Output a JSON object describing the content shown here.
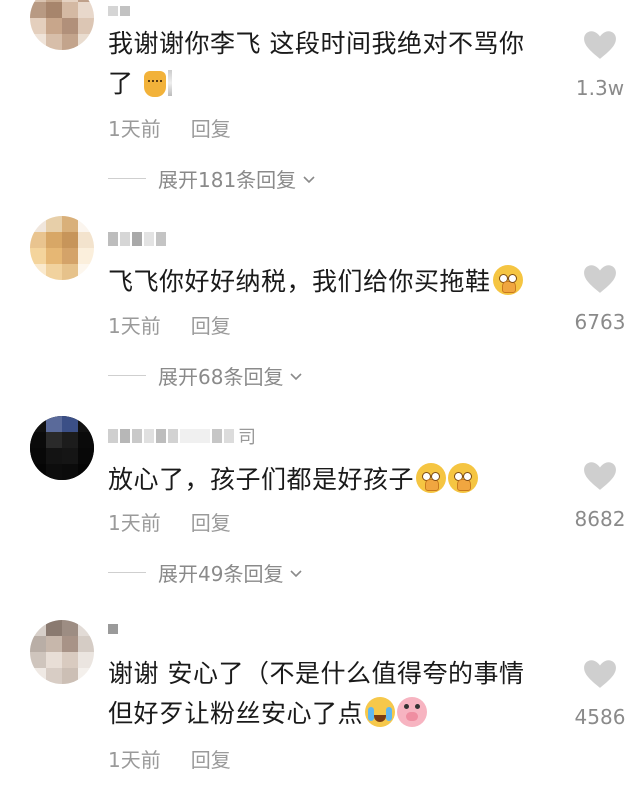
{
  "colors": {
    "heart": "#cfcfcf",
    "meta_text": "#9a9a9a",
    "body_text": "#1a1a1a"
  },
  "comments": [
    {
      "text_lines": [
        "我谢谢你李飞 这段时间我绝对不骂你",
        "了"
      ],
      "emojis": [
        "cat-emoji"
      ],
      "time": "1天前",
      "reply_label": "回复",
      "likes": "1.3w",
      "expand_label": "展开181条回复"
    },
    {
      "text_lines": [
        "飞飞你好好纳税，我们给你买拖鞋"
      ],
      "emojis": [
        "pray-emoji"
      ],
      "time": "1天前",
      "reply_label": "回复",
      "likes": "6763",
      "expand_label": "展开68条回复"
    },
    {
      "username_fragment": "司",
      "text_lines": [
        "放心了，孩子们都是好孩子"
      ],
      "emojis": [
        "pray-emoji",
        "pray-emoji"
      ],
      "time": "1天前",
      "reply_label": "回复",
      "likes": "8682",
      "expand_label": "展开49条回复"
    },
    {
      "text_lines": [
        "谢谢 安心了（不是什么值得夸的事情",
        "但好歹让粉丝安心了点"
      ],
      "emojis": [
        "cry-emoji",
        "pig-emoji"
      ],
      "time": "1天前",
      "reply_label": "回复",
      "likes": "4586"
    }
  ]
}
